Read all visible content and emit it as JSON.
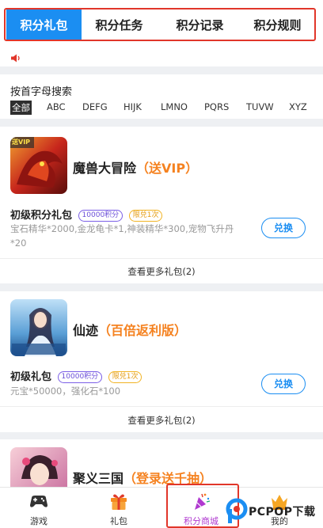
{
  "tabs": [
    {
      "label": "积分礼包",
      "active": true
    },
    {
      "label": "积分任务",
      "active": false
    },
    {
      "label": "积分记录",
      "active": false
    },
    {
      "label": "积分规则",
      "active": false
    }
  ],
  "alphabet": {
    "title": "按首字母搜索",
    "items": [
      "全部",
      "ABC",
      "DEFG",
      "HIJK",
      "LMNO",
      "PQRS",
      "TUVW",
      "XYZ"
    ],
    "selected": "全部"
  },
  "games": [
    {
      "name": "魔兽大冒险",
      "promo": "（送VIP）",
      "thumb_label": "送VIP",
      "pack": {
        "name": "初级积分礼包",
        "points": "10000积分",
        "limit": "限兑1次",
        "desc": "宝石精华*2000,金龙龟卡*1,神装精华*300,宠物飞升丹*20"
      },
      "button": "兑换",
      "more": "查看更多礼包(2)"
    },
    {
      "name": "仙迹",
      "promo": "（百倍返利版）",
      "pack": {
        "name": "初级礼包",
        "points": "10000积分",
        "limit": "限兑1次",
        "desc": "元宝*50000，强化石*100"
      },
      "button": "兑换",
      "more": "查看更多礼包(2)"
    },
    {
      "name": "聚义三国",
      "promo": "（登录送千抽）"
    }
  ],
  "nav": [
    {
      "label": "游戏",
      "icon": "gamepad-icon"
    },
    {
      "label": "礼包",
      "icon": "gift-icon"
    },
    {
      "label": "积分商城",
      "icon": "party-popper-icon",
      "active": true
    },
    {
      "label": "我的",
      "icon": "crown-icon"
    }
  ],
  "watermark": {
    "text": "PCPOP下载"
  },
  "colors": {
    "accent": "#1b8ef2",
    "promo": "#f58220",
    "highlight": "#e1362a",
    "badge_points": "#6b4fd8",
    "badge_limit": "#e49b0f"
  }
}
